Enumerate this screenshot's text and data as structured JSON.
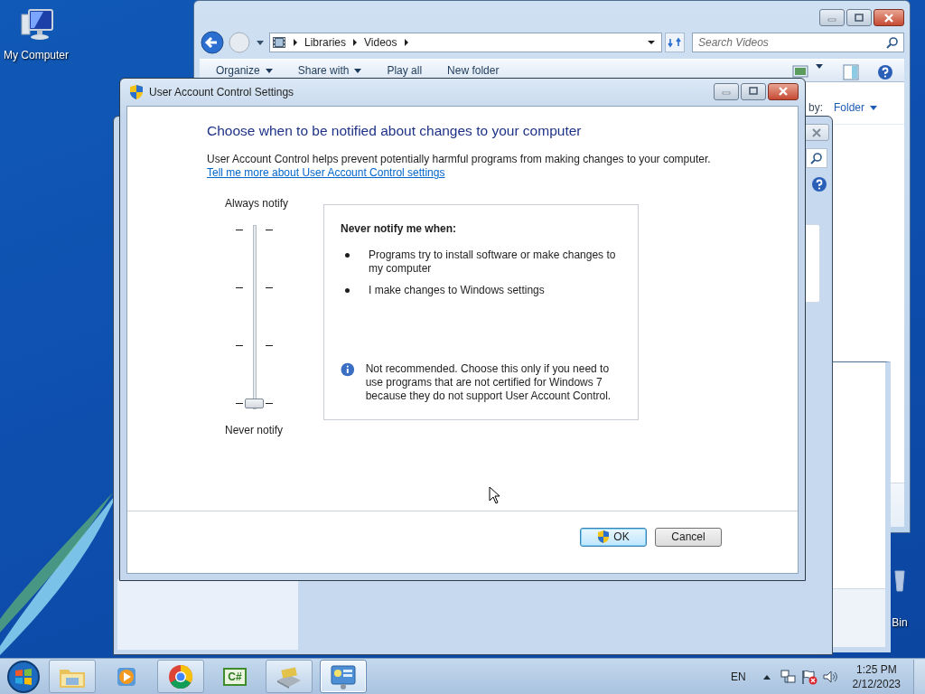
{
  "desktop": {
    "icons": [
      {
        "kind": "computer",
        "label": "My Computer"
      },
      {
        "kind": "bin",
        "label": "Bin"
      }
    ]
  },
  "explorer": {
    "breadcrumbs": [
      "Libraries",
      "Videos"
    ],
    "search": {
      "placeholder": "Search Videos"
    },
    "toolbar": [
      {
        "label": "Organize",
        "dropdown": true
      },
      {
        "label": "Share with",
        "dropdown": true
      },
      {
        "label": "Play all",
        "dropdown": false
      },
      {
        "label": "New folder",
        "dropdown": false
      }
    ],
    "arrange": {
      "label": "by:",
      "value": "Folder"
    }
  },
  "uac": {
    "title": "User Account Control Settings",
    "heading": "Choose when to be notified about changes to your computer",
    "description": "User Account Control helps prevent potentially harmful programs from making changes to your computer.",
    "link": "Tell me more about User Account Control settings",
    "slider": {
      "top_label": "Always notify",
      "bottom_label": "Never notify",
      "level": 0
    },
    "info": {
      "title": "Never notify me when:",
      "bullets": [
        "Programs try to install software or make changes to my computer",
        "I make changes to Windows settings"
      ],
      "note": "Not recommended. Choose this only if you need to use programs that are not certified for Windows 7 because they do not support User Account Control."
    },
    "buttons": [
      {
        "label": "OK",
        "default": true,
        "shield": true
      },
      {
        "label": "Cancel",
        "default": false,
        "shield": false
      }
    ]
  },
  "taskbar": {
    "apps": [
      {
        "kind": "explorer",
        "running": true,
        "selected": false
      },
      {
        "kind": "media",
        "running": false,
        "selected": false
      },
      {
        "kind": "browser",
        "running": true,
        "selected": false
      },
      {
        "kind": "csharp",
        "label": "C#",
        "running": false,
        "selected": false
      },
      {
        "kind": "tool",
        "running": true,
        "selected": false
      },
      {
        "kind": "control",
        "running": true,
        "selected": true
      }
    ],
    "tray": {
      "language": "EN",
      "time": "1:25 PM",
      "date": "2/12/2023"
    }
  }
}
